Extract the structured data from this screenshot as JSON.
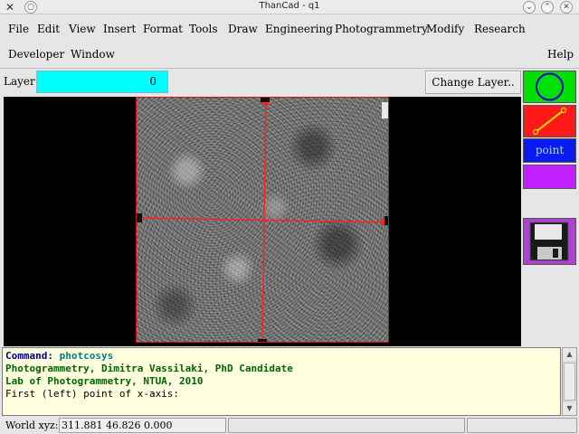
{
  "window": {
    "title": "ThanCad - q1",
    "app_icon": "x-logo-icon",
    "controls": [
      "minimize-icon",
      "maximize-icon",
      "close-icon"
    ]
  },
  "menu": {
    "items": [
      "File",
      "Edit",
      "View",
      "Insert",
      "Format",
      "Tools",
      "Draw",
      "Engineering",
      "Photogrammetry",
      "Modify",
      "Research",
      "Developer",
      "Window",
      "Help"
    ]
  },
  "layer": {
    "label": "Layer:",
    "value": "0",
    "change_button": "Change Layer.."
  },
  "toolbar": {
    "circle_icon": "circle-icon",
    "line_icon": "line-icon",
    "point_label": "point",
    "magenta_label": "",
    "save_icon": "floppy-disk-icon",
    "colors": {
      "circle": "#00e000",
      "line": "#ff1a1a",
      "point": "#0a1af0",
      "magenta": "#c020ff",
      "save": "#b040d8"
    }
  },
  "canvas": {
    "background": "#000000",
    "axis_color": "#ff2020"
  },
  "command": {
    "label": "Command:",
    "value": "photcosys",
    "lines": [
      "Photogrammetry, Dimitra Vassilaki, PhD Candidate",
      "Lab of Photogrammetry, NTUA, 2010",
      "First (left) point of x-axis:"
    ]
  },
  "status": {
    "label": "World xyz:",
    "value": "311.881 46.826 0.000"
  }
}
